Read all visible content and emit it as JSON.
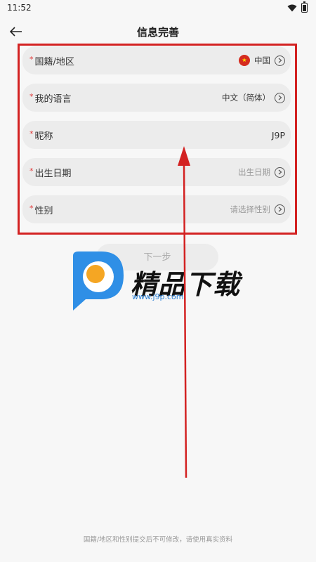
{
  "status": {
    "time": "11:52"
  },
  "header": {
    "title": "信息完善"
  },
  "form": {
    "country": {
      "star": "*",
      "label": "国籍/地区",
      "value": "中国"
    },
    "language": {
      "star": "*",
      "label": "我的语言",
      "value": "中文（简体）"
    },
    "nickname": {
      "star": "*",
      "label": "昵称",
      "value": "J9P"
    },
    "birthday": {
      "star": "*",
      "label": "出生日期",
      "placeholder": "出生日期"
    },
    "gender": {
      "star": "*",
      "label": "性别",
      "placeholder": "请选择性别"
    }
  },
  "next_button": {
    "label": "下一步"
  },
  "watermark": {
    "text": "精品下载",
    "url": "www.j9p.com"
  },
  "footnote": "国籍/地区和性别提交后不可修改，请使用真实资料",
  "colors": {
    "annotation": "#d32222",
    "star": "#e03a3a",
    "watermark_blue": "#2f8fe6",
    "watermark_orange": "#f5a623"
  }
}
